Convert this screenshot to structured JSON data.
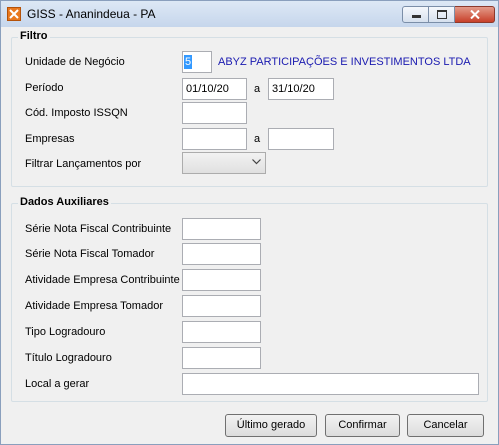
{
  "window": {
    "title": "GISS - Ananindeua - PA"
  },
  "filtro": {
    "legend": "Filtro",
    "unidade_label": "Unidade de Negócio",
    "unidade_code": "5",
    "unidade_name": "ABYZ PARTICIPAÇÕES E INVESTIMENTOS LTDA",
    "periodo_label": "Período",
    "periodo_start": "01/10/20",
    "periodo_sep": "a",
    "periodo_end": "31/10/20",
    "imposto_label": "Cód. Imposto ISSQN",
    "imposto_value": "",
    "empresas_label": "Empresas",
    "empresas_start": "",
    "empresas_sep": "a",
    "empresas_end": "",
    "filtrar_label": "Filtrar Lançamentos por",
    "filtrar_value": ""
  },
  "auxiliares": {
    "legend": "Dados Auxiliares",
    "serie_contribuinte_label": "Série Nota Fiscal Contribuinte",
    "serie_tomador_label": "Série Nota Fiscal Tomador",
    "atividade_contribuinte_label": "Atividade Empresa Contribuinte",
    "atividade_tomador_label": "Atividade Empresa Tomador",
    "tipo_logradouro_label": "Tipo Logradouro",
    "titulo_logradouro_label": "Título Logradouro",
    "local_gerar_label": "Local a gerar"
  },
  "buttons": {
    "ultimo_gerado": "Último gerado",
    "confirmar": "Confirmar",
    "cancelar": "Cancelar"
  }
}
